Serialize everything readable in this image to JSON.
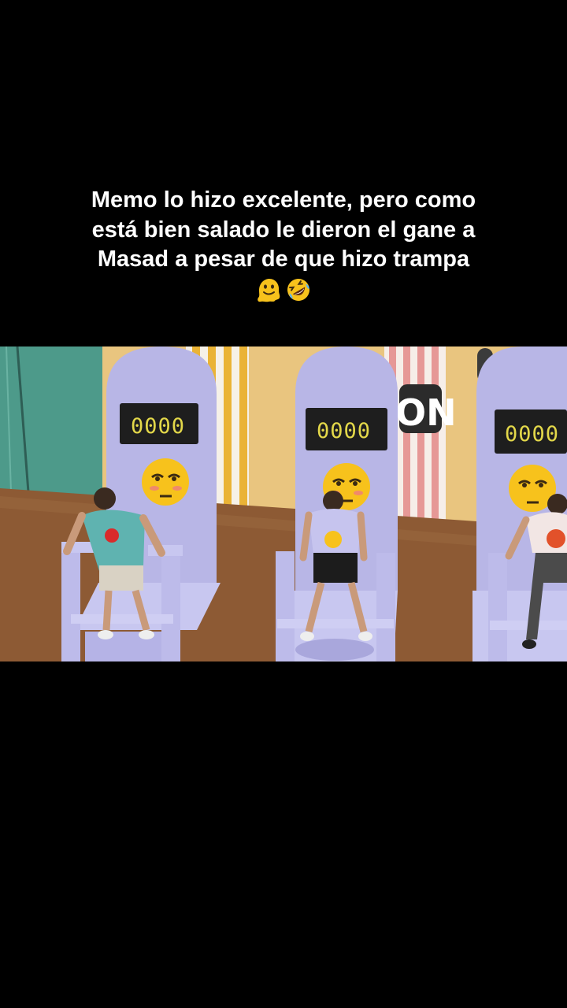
{
  "caption": {
    "lines": [
      "Memo lo hizo excelente, pero como",
      "está bien salado le dieron el gane a",
      "Masad a pesar de que hizo trampa"
    ],
    "emojis": [
      "melting-face-icon",
      "rolling-on-floor-laughing-icon"
    ]
  },
  "scene": {
    "counters": [
      "0000",
      "0000",
      "0000"
    ],
    "sign_text": "ON"
  }
}
